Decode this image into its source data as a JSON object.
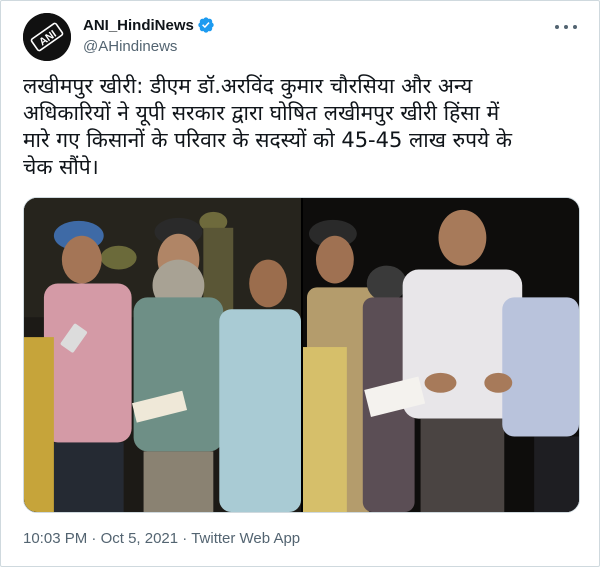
{
  "user": {
    "display_name": "ANI_HindiNews",
    "handle": "@AHindinews",
    "verified": true,
    "avatar_logo_text": "ANI"
  },
  "tweet": {
    "text_lines": [
      "लखीमपुर खीरी: डीएम डॉ.अरविंद कुमार चौरसिया और अन्य",
      "अधिकारियों ने यूपी सरकार द्वारा घोषित लखीमपुर खीरी हिंसा में",
      "मारे गए किसानों के परिवार के सदस्यों को 45-45 लाख रुपये के",
      "चेक सौंपे।"
    ]
  },
  "meta": {
    "time": "10:03 PM",
    "separator1": " · ",
    "date": "Oct 5, 2021",
    "separator2": " · ",
    "source": "Twitter Web App"
  },
  "icons": {
    "verified": "verified-badge-icon",
    "more": "more-options-icon"
  },
  "colors": {
    "text_primary": "#0f1419",
    "text_secondary": "#536471",
    "verified_blue": "#1d9bf0",
    "border": "#cfd9de"
  }
}
